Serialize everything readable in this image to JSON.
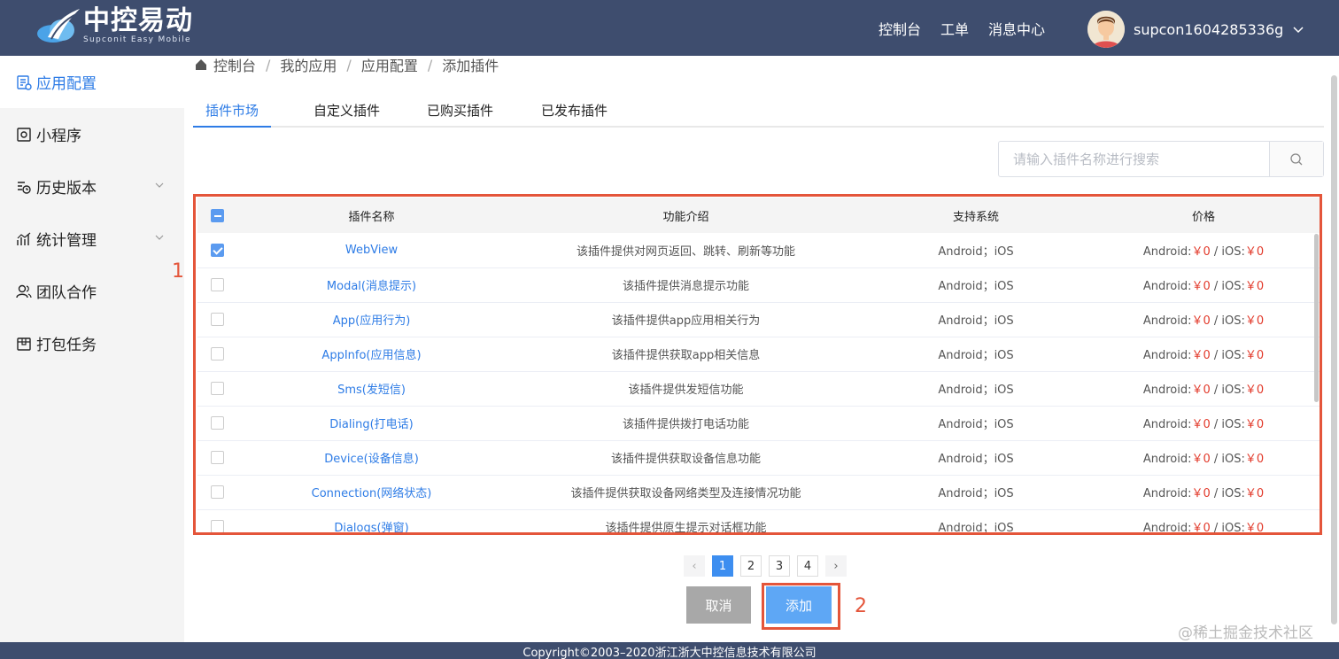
{
  "header": {
    "logo_title": "中控易动",
    "logo_sub": "Supconit Easy Mobile",
    "nav": [
      "控制台",
      "工单",
      "消息中心"
    ],
    "username": "supcon1604285336g"
  },
  "sidebar": {
    "items": [
      {
        "label": "应用配置",
        "icon": "app-config-icon",
        "active": true
      },
      {
        "label": "小程序",
        "icon": "miniprogram-icon"
      },
      {
        "label": "历史版本",
        "icon": "history-icon",
        "expandable": true
      },
      {
        "label": "统计管理",
        "icon": "stats-icon",
        "expandable": true
      },
      {
        "label": "团队合作",
        "icon": "team-icon"
      },
      {
        "label": "打包任务",
        "icon": "package-icon"
      }
    ]
  },
  "breadcrumb": [
    "控制台",
    "我的应用",
    "应用配置",
    "添加插件"
  ],
  "tabs": [
    "插件市场",
    "自定义插件",
    "已购买插件",
    "已发布插件"
  ],
  "search": {
    "placeholder": "请输入插件名称进行搜索"
  },
  "table": {
    "headers": [
      "插件名称",
      "功能介绍",
      "支持系统",
      "价格"
    ],
    "rows": [
      {
        "name": "WebView",
        "desc": "该插件提供对网页返回、跳转、刷新等功能",
        "sys": "Android；iOS",
        "checked": true
      },
      {
        "name": "Modal(消息提示)",
        "desc": "该插件提供消息提示功能",
        "sys": "Android；iOS",
        "checked": false
      },
      {
        "name": "App(应用行为)",
        "desc": "该插件提供app应用相关行为",
        "sys": "Android；iOS",
        "checked": false
      },
      {
        "name": "AppInfo(应用信息)",
        "desc": "该插件提供获取app相关信息",
        "sys": "Android；iOS",
        "checked": false
      },
      {
        "name": "Sms(发短信)",
        "desc": "该插件提供发短信功能",
        "sys": "Android；iOS",
        "checked": false
      },
      {
        "name": "Dialing(打电话)",
        "desc": "该插件提供拨打电话功能",
        "sys": "Android；iOS",
        "checked": false
      },
      {
        "name": "Device(设备信息)",
        "desc": "该插件提供获取设备信息功能",
        "sys": "Android；iOS",
        "checked": false
      },
      {
        "name": "Connection(网络状态)",
        "desc": "该插件提供获取设备网络类型及连接情况功能",
        "sys": "Android；iOS",
        "checked": false
      },
      {
        "name": "Dialogs(弹窗)",
        "desc": "该插件提供原生提示对话框功能",
        "sys": "Android；iOS",
        "checked": false
      }
    ],
    "price": {
      "android_label": "Android:",
      "android_value": "￥0",
      "sep": " / ",
      "ios_label": "iOS:",
      "ios_value": "￥0"
    }
  },
  "annotations": {
    "table": "1",
    "add": "2"
  },
  "pagination": {
    "pages": [
      "1",
      "2",
      "3",
      "4"
    ],
    "current": "1"
  },
  "buttons": {
    "cancel": "取消",
    "add": "添加"
  },
  "footer": "Copyright©2003–2020浙江浙大中控信息技术有限公司",
  "watermark": "@稀土掘金技术社区",
  "colors": {
    "header": "#3e4d6e",
    "accent": "#2e7ce6",
    "annotation": "#e4553a",
    "price": "#e23a2b"
  }
}
